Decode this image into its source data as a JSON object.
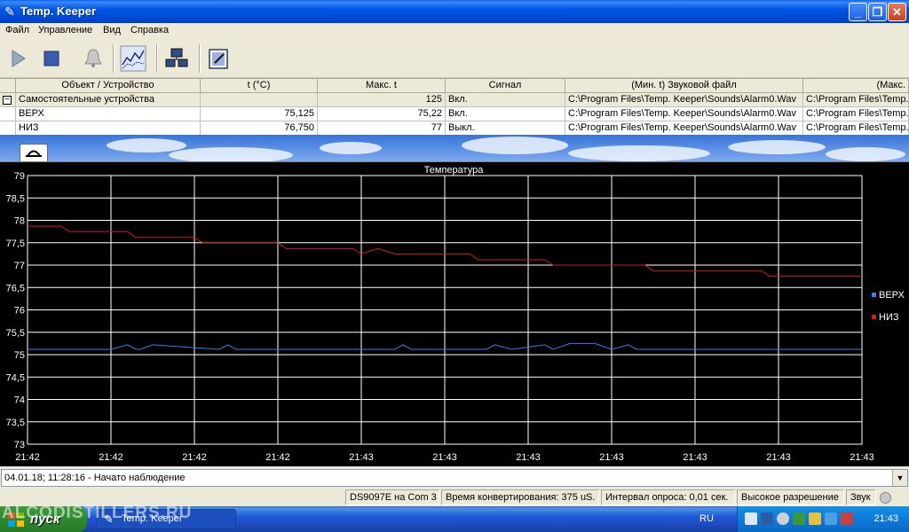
{
  "window": {
    "title": "Temp. Keeper",
    "icon": "thermometer-icon"
  },
  "menu": [
    "Файл",
    "Управление",
    "Вид",
    "Справка"
  ],
  "toolbar": [
    "play-icon",
    "stop-icon",
    "bell-icon",
    "chart-icon",
    "network-icon",
    "edit-icon"
  ],
  "grid": {
    "headers": [
      "Объект / Устройство",
      "t (°C)",
      "Макс. t",
      "Сигнал",
      "(Мин. t) Звуковой файл",
      "(Макс."
    ],
    "group_row": {
      "name": "Самостоятельные устройства",
      "t": "",
      "max_t": "125",
      "signal": "Вкл.",
      "min_file": "C:\\Program Files\\Temp. Keeper\\Sounds\\Alarm0.Wav",
      "max_file": "C:\\Program Files\\Temp."
    },
    "rows": [
      {
        "name": "ВЕРХ",
        "t": "75,125",
        "max_t": "75,22",
        "signal": "Вкл.",
        "min_file": "C:\\Program Files\\Temp. Keeper\\Sounds\\Alarm0.Wav",
        "max_file": "C:\\Program Files\\Temp."
      },
      {
        "name": "НИЗ",
        "t": "76,750",
        "max_t": "77",
        "signal": "Выкл.",
        "min_file": "C:\\Program Files\\Temp. Keeper\\Sounds\\Alarm0.Wav",
        "max_file": "C:\\Program Files\\Temp."
      }
    ]
  },
  "chart_data": {
    "type": "line",
    "title": "Температура",
    "y_ticks": [
      "79",
      "78,5",
      "78",
      "77,5",
      "77",
      "76,5",
      "76",
      "75,5",
      "75",
      "74,5",
      "74",
      "73,5",
      "73"
    ],
    "ylim": [
      73,
      79
    ],
    "x_ticks": [
      "21:42",
      "21:42",
      "21:42",
      "21:42",
      "21:43",
      "21:43",
      "21:43",
      "21:43",
      "21:43",
      "21:43",
      "21:43"
    ],
    "grid": true,
    "legend_position": "right",
    "colors": {
      "ВЕРХ": "#3a7ee8",
      "НИЗ": "#d01c1c"
    },
    "series": [
      {
        "name": "ВЕРХ",
        "x": [
          0,
          1,
          1.2,
          1.3,
          1.35,
          1.5,
          2.3,
          2.4,
          2.5,
          4.4,
          4.5,
          4.6,
          5.5,
          5.6,
          5.8,
          6.2,
          6.3,
          6.5,
          6.8,
          7.0,
          7.2,
          7.3,
          7.5,
          10
        ],
        "values": [
          75.12,
          75.12,
          75.22,
          75.12,
          75.12,
          75.22,
          75.12,
          75.22,
          75.12,
          75.12,
          75.22,
          75.12,
          75.12,
          75.22,
          75.12,
          75.22,
          75.12,
          75.25,
          75.25,
          75.12,
          75.22,
          75.12,
          75.12,
          75.12
        ]
      },
      {
        "name": "НИЗ",
        "x": [
          0,
          0.4,
          0.5,
          1.2,
          1.3,
          2.0,
          2.1,
          3.0,
          3.1,
          3.9,
          4.0,
          4.2,
          4.4,
          5.3,
          5.4,
          6.2,
          6.3,
          7.4,
          7.5,
          8.8,
          8.9,
          10
        ],
        "values": [
          77.87,
          77.87,
          77.75,
          77.75,
          77.62,
          77.62,
          77.5,
          77.5,
          77.37,
          77.37,
          77.25,
          77.37,
          77.25,
          77.25,
          77.12,
          77.12,
          77.0,
          77.0,
          76.87,
          76.87,
          76.75,
          76.75
        ]
      }
    ]
  },
  "log": {
    "text": "04.01.18; 11:28:16 - Начато наблюдение"
  },
  "status": [
    "DS9097E на Com 3",
    "Время конвертирования: 375 uS.",
    "Интервал опроса: 0,01 сек.",
    "Высокое разрешение",
    "Звук"
  ],
  "taskbar": {
    "start": "пуск",
    "task": "Temp. Keeper",
    "lang": "RU",
    "clock": "21:43",
    "watermark": "ALCODISTILLERS.RU"
  }
}
